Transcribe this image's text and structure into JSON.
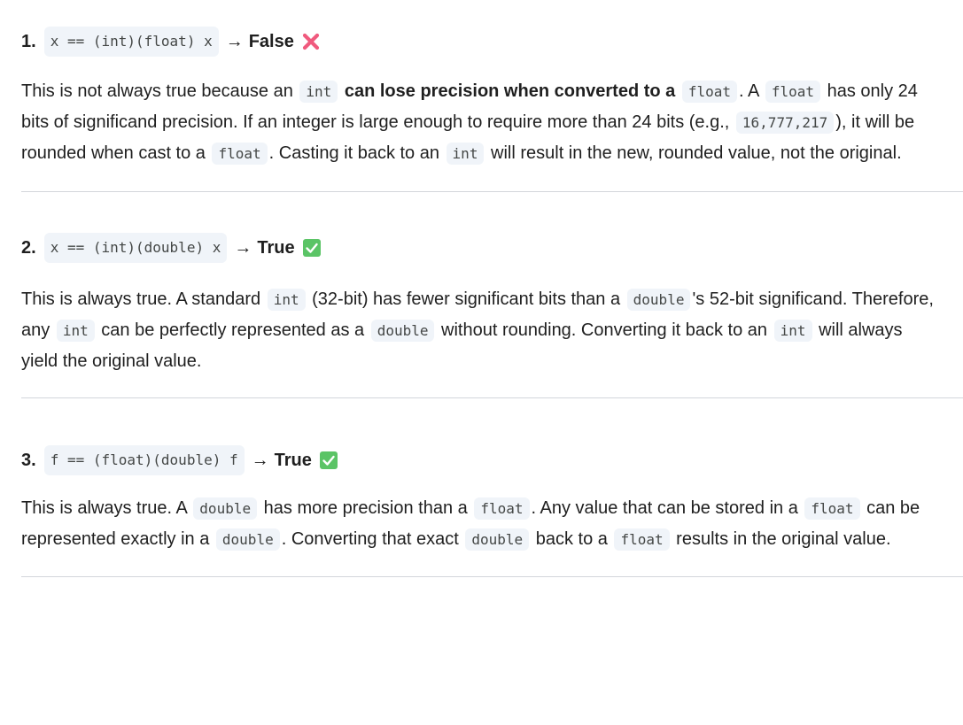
{
  "items": [
    {
      "num": "1.",
      "expr": "x == (int)(float) x",
      "arrow": "→",
      "verdict": "False",
      "verdict_icon": "cross-mark-icon",
      "para": [
        "This is not always true because an ",
        "int",
        " ",
        "can lose precision when converted to a",
        " ",
        "float",
        ". A ",
        "float",
        " has only 24 bits of significand precision. If an integer is large enough to require more than 24 bits (e.g., ",
        "16,777,217",
        "), it will be rounded when cast to a ",
        "float",
        ". Casting it back to an ",
        "int",
        " will result in the new, rounded value, not the original."
      ]
    },
    {
      "num": "2.",
      "expr": "x == (int)(double) x",
      "arrow": "→",
      "verdict": "True",
      "verdict_icon": "check-mark-icon",
      "para": [
        "This is always true. A standard ",
        "int",
        " (32-bit) has fewer significant bits than a ",
        "double",
        "'s 52-bit significand. Therefore, any ",
        "int",
        " can be perfectly represented as a ",
        "double",
        " without rounding. Converting it back to an ",
        "int",
        " will always yield the original value."
      ]
    },
    {
      "num": "3.",
      "expr": "f == (float)(double) f",
      "arrow": "→",
      "verdict": "True",
      "verdict_icon": "check-mark-icon",
      "para": [
        "This is always true. A ",
        "double",
        " has more precision than a ",
        "float",
        ". Any value that can be stored in a ",
        "float",
        " can be represented exactly in a ",
        "double",
        ". Converting that exact ",
        "double",
        " back to a ",
        "float",
        " results in the original value."
      ]
    }
  ],
  "colors": {
    "cross": "#f05a7e",
    "check": "#5bc466",
    "code_bg": "#f0f4f9",
    "separator": "#d3d6db"
  }
}
